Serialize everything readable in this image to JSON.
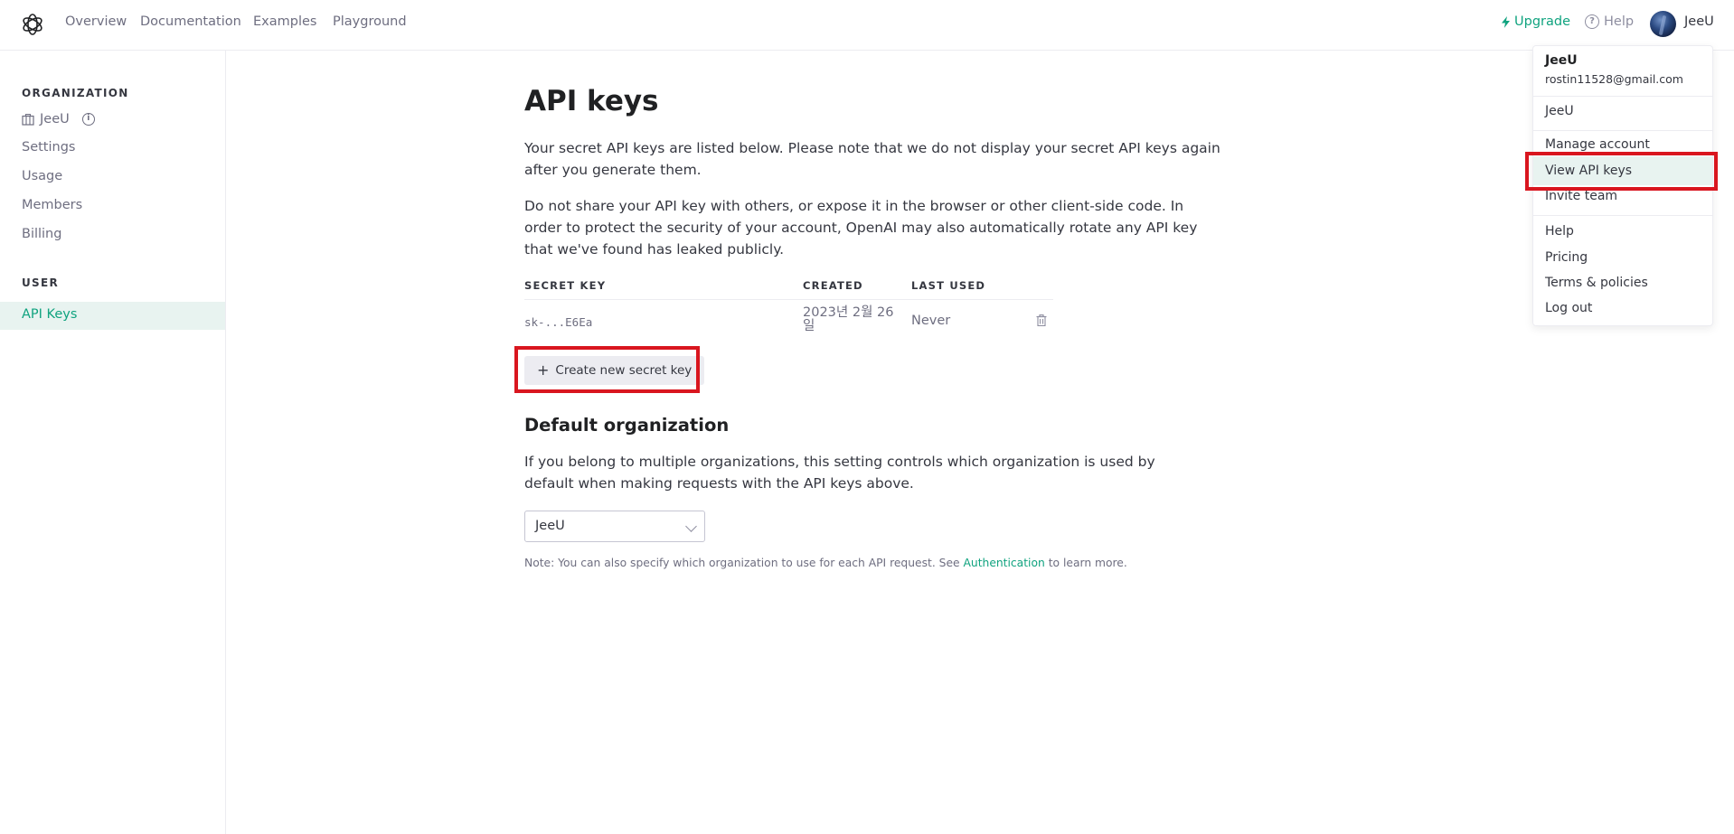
{
  "nav": {
    "links": [
      "Overview",
      "Documentation",
      "Examples",
      "Playground"
    ],
    "upgrade_label": "Upgrade",
    "help_label": "Help",
    "user_name": "JeeU"
  },
  "sidebar": {
    "org_heading": "ORGANIZATION",
    "org_name": "JeeU",
    "org_links": [
      "Settings",
      "Usage",
      "Members",
      "Billing"
    ],
    "user_heading": "USER",
    "active_item": "API Keys"
  },
  "main": {
    "title": "API keys",
    "intro": "Your secret API keys are listed below. Please note that we do not display your secret API keys again after you generate them.",
    "warning": "Do not share your API key with others, or expose it in the browser or other client-side code. In order to protect the security of your account, OpenAI may also automatically rotate any API key that we've found has leaked publicly.",
    "table": {
      "headers": [
        "SECRET KEY",
        "CREATED",
        "LAST USED"
      ],
      "rows": [
        {
          "key": "sk-...E6Ea",
          "created": "2023년 2월 26일",
          "last_used": "Never"
        }
      ]
    },
    "create_button": "Create new secret key",
    "default_org_heading": "Default organization",
    "default_org_text": "If you belong to multiple organizations, this setting controls which organization is used by default when making requests with the API keys above.",
    "org_select_value": "JeeU",
    "note_prefix": "Note: You can also specify which organization to use for each API request. See",
    "note_link": "Authentication",
    "note_suffix": "to learn more."
  },
  "menu": {
    "name": "JeeU",
    "email": "rostin11528@gmail.com",
    "org": "JeeU",
    "account_items": [
      "Manage account",
      "View API keys",
      "Invite team"
    ],
    "other_items": [
      "Help",
      "Pricing",
      "Terms & policies",
      "Log out"
    ]
  },
  "colors": {
    "accent": "#10a37f",
    "highlight_box": "#d9161f",
    "active_bg": "#e8f3f0"
  }
}
